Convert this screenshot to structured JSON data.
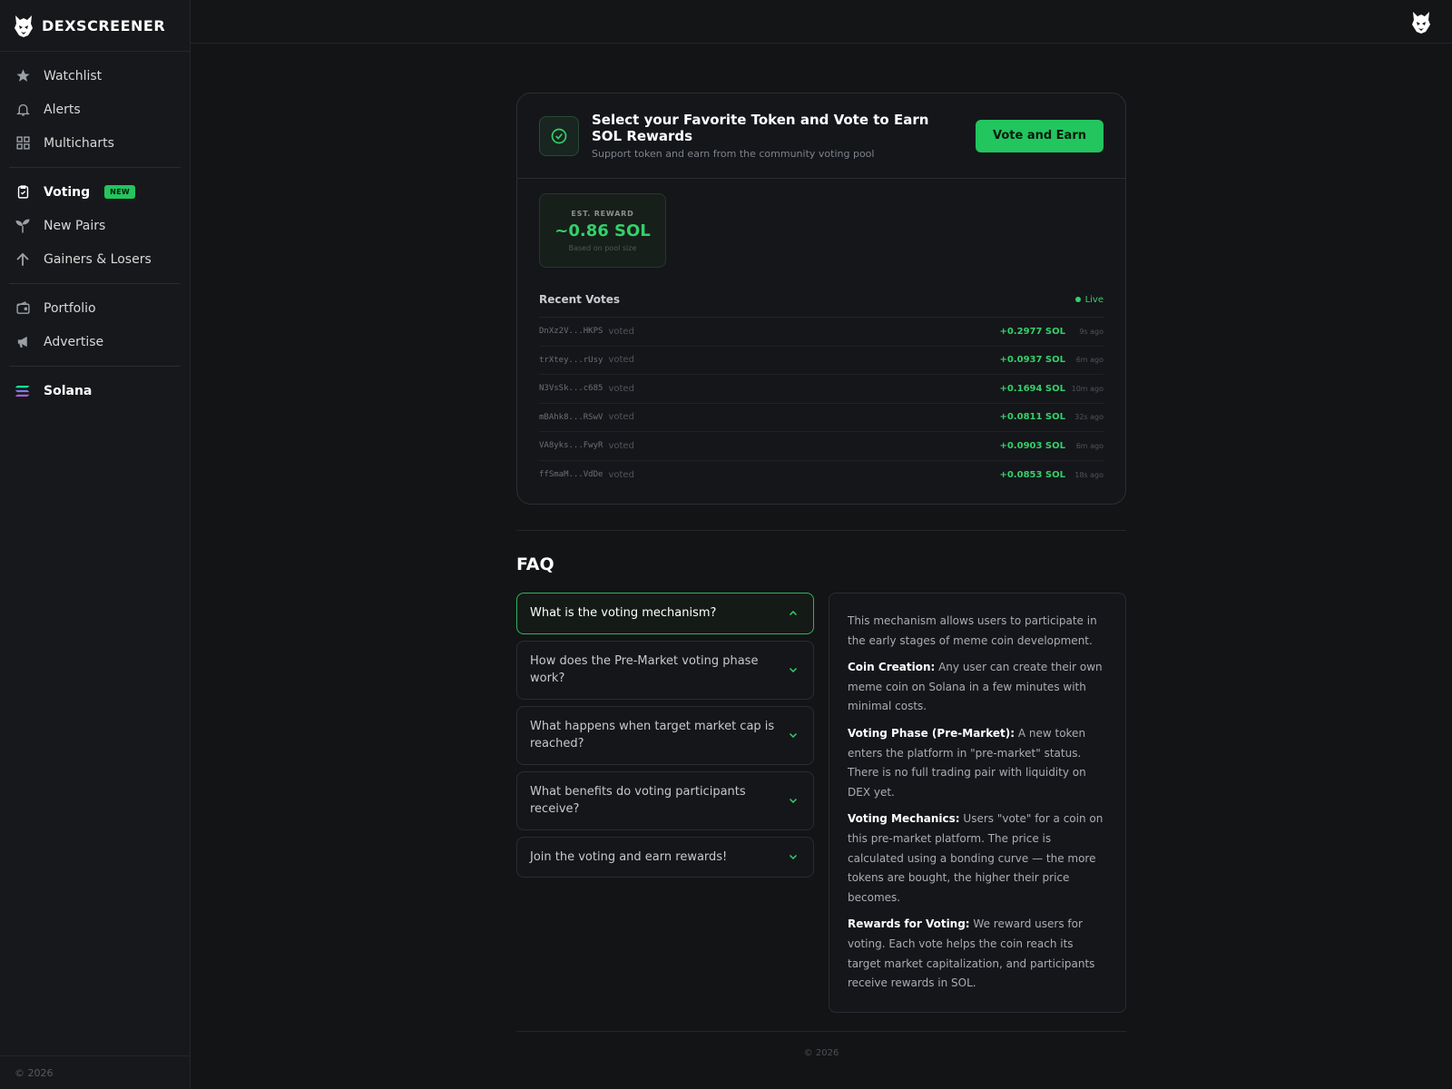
{
  "sidebar": {
    "brand": "DEXSCREENER",
    "group1": [
      {
        "label": "Watchlist",
        "icon": "star-icon"
      },
      {
        "label": "Alerts",
        "icon": "bell-icon"
      },
      {
        "label": "Multicharts",
        "icon": "grid-icon"
      }
    ],
    "group2": [
      {
        "label": "Voting",
        "icon": "clipboard-check-icon",
        "badge": "NEW"
      },
      {
        "label": "New Pairs",
        "icon": "sprout-icon"
      },
      {
        "label": "Gainers & Losers",
        "icon": "arrow-up-icon"
      }
    ],
    "group3": [
      {
        "label": "Portfolio",
        "icon": "wallet-icon"
      },
      {
        "label": "Advertise",
        "icon": "megaphone-icon"
      }
    ],
    "chain": {
      "label": "Solana",
      "icon": "solana-icon"
    },
    "footer": "© 2026"
  },
  "vote": {
    "title": "Select your Favorite Token and Vote to Earn SOL Rewards",
    "subtitle": "Support token and earn from the community voting pool",
    "button": "Vote and Earn",
    "reward_label": "EST. REWARD",
    "reward_value": "~0.86 SOL",
    "reward_note": "Based on pool size",
    "recent_title": "Recent Votes",
    "live_label": "Live",
    "voted_word": "voted",
    "rows": [
      {
        "addr": "DnXz2V...HKPS",
        "amount": "+0.2977 SOL",
        "time": "9s ago"
      },
      {
        "addr": "trXtey...rUsy",
        "amount": "+0.0937 SOL",
        "time": "6m ago"
      },
      {
        "addr": "N3VsSk...c685",
        "amount": "+0.1694 SOL",
        "time": "10m ago"
      },
      {
        "addr": "mBAhk8...RSwV",
        "amount": "+0.0811 SOL",
        "time": "32s ago"
      },
      {
        "addr": "VA8yks...FwyR",
        "amount": "+0.0903 SOL",
        "time": "6m ago"
      },
      {
        "addr": "ffSmaM...VdDe",
        "amount": "+0.0853 SOL",
        "time": "18s ago"
      }
    ]
  },
  "faq": {
    "title": "FAQ",
    "questions": [
      "What is the voting mechanism?",
      "How does the Pre-Market voting phase work?",
      "What happens when target market cap is reached?",
      "What benefits do voting participants receive?",
      "Join the voting and earn rewards!"
    ],
    "answer": {
      "intro": "This mechanism allows users to participate in the early stages of meme coin development.",
      "p1_label": "Coin Creation:",
      "p1_text": " Any user can create their own meme coin on Solana in a few minutes with minimal costs.",
      "p2_label": "Voting Phase (Pre-Market):",
      "p2_text": " A new token enters the platform in \"pre-market\" status. There is no full trading pair with liquidity on DEX yet.",
      "p3_label": "Voting Mechanics:",
      "p3_text": " Users \"vote\" for a coin on this pre-market platform. The price is calculated using a bonding curve — the more tokens are bought, the higher their price becomes.",
      "p4_label": "Rewards for Voting:",
      "p4_text": " We reward users for voting. Each vote helps the coin reach its target market capitalization, and participants receive rewards in SOL."
    }
  },
  "footer": {
    "copy": "© 2026"
  },
  "colors": {
    "accent": "#22c55e",
    "background": "#131416"
  }
}
